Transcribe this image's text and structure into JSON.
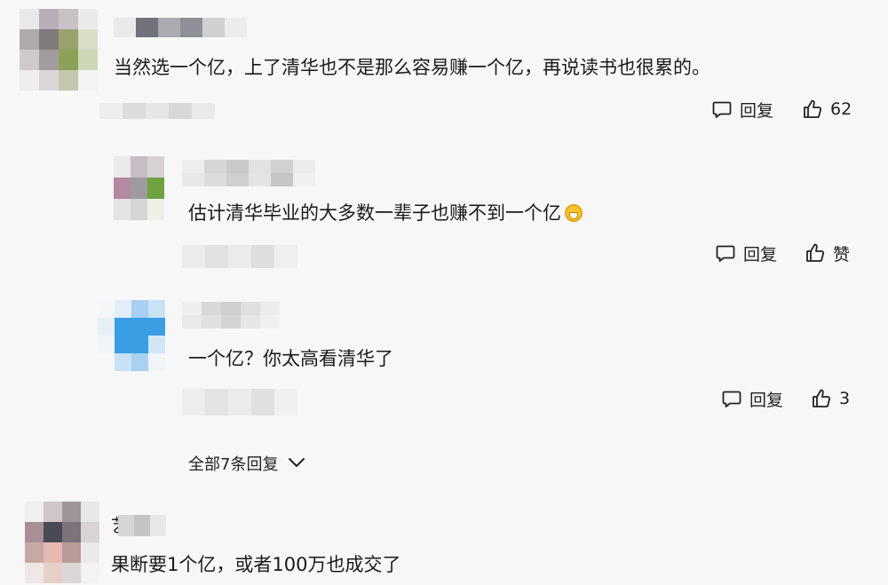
{
  "comments": [
    {
      "text": "当然选一个亿，上了清华也不是那么容易赚一个亿，再说读书也很累的。",
      "reply_label": "回复",
      "like_label": "62"
    },
    {
      "text": "估计清华毕业的大多数一辈子也赚不到一个亿",
      "reply_label": "回复",
      "like_label": "赞",
      "emoji_icon": "grinning-face-emoji"
    },
    {
      "text": "一个亿？你太高看清华了",
      "reply_label": "回复",
      "like_label": "3"
    },
    {
      "text": "果断要1个亿，或者100万也成交了"
    }
  ],
  "expand_replies_label": "全部7条回复",
  "partial_name_glyph": "艺",
  "colors": {
    "accent_blue": "#3a9ee4",
    "text": "#1b1b1b",
    "background": "#f7f7f8"
  }
}
